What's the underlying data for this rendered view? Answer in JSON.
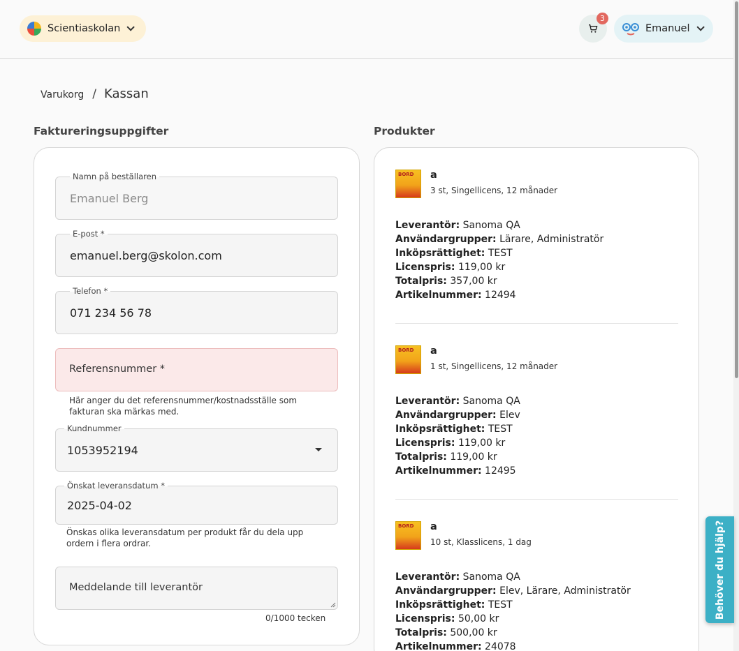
{
  "header": {
    "school_name": "Scientiaskolan",
    "cart_count": "3",
    "user_name": "Emanuel",
    "colors": {
      "school_chip_bg": "#fdf1d6",
      "user_chip_bg": "#e4f3f6",
      "badge": "#e2685f",
      "help_tab": "#3cb0c6"
    }
  },
  "breadcrumb": {
    "link": "Varukorg",
    "separator": "/",
    "current": "Kassan"
  },
  "billing": {
    "title": "Faktureringsuppgifter",
    "fields": {
      "name": {
        "label": "Namn på beställaren",
        "value": "Emanuel Berg"
      },
      "email": {
        "label": "E-post *",
        "value": "emanuel.berg@skolon.com"
      },
      "phone": {
        "label": "Telefon *",
        "value": "071 234 56 78"
      },
      "reference": {
        "placeholder": "Referensnummer *",
        "helper": "Här anger du det referensnummer/kostnadsställe som fakturan ska märkas med."
      },
      "customer": {
        "label": "Kundnummer",
        "value": "1053952194"
      },
      "delivery": {
        "label": "Önskat leveransdatum *",
        "value": "2025-04-02",
        "helper": "Önskas olika leveransdatum per produkt får du dela upp ordern i flera ordrar."
      },
      "message": {
        "placeholder": "Meddelande till leverantör",
        "counter": "0/1000 tecken"
      }
    }
  },
  "products": {
    "title": "Produkter",
    "labels": {
      "supplier": "Leverantör:",
      "groups": "Användargrupper:",
      "right": "Inköpsrättighet:",
      "license_price": "Licenspris:",
      "total": "Totalpris:",
      "article": "Artikelnummer:"
    },
    "items": [
      {
        "title": "a",
        "subtitle": "3 st, Singellicens, 12 månader",
        "supplier": "Sanoma QA",
        "groups": "Lärare, Administratör",
        "right": "TEST",
        "license_price": "119,00 kr",
        "total": "357,00 kr",
        "article": "12494"
      },
      {
        "title": "a",
        "subtitle": "1 st, Singellicens, 12 månader",
        "supplier": "Sanoma QA",
        "groups": "Elev",
        "right": "TEST",
        "license_price": "119,00 kr",
        "total": "119,00 kr",
        "article": "12495"
      },
      {
        "title": "a",
        "subtitle": "10 st, Klasslicens, 1 dag",
        "supplier": "Sanoma QA",
        "groups": "Elev, Lärare, Administratör",
        "right": "TEST",
        "license_price": "50,00 kr",
        "total": "500,00 kr",
        "article": "24078"
      }
    ]
  },
  "help": {
    "label": "Behöver du hjälp?",
    "icon": "help-tab"
  }
}
